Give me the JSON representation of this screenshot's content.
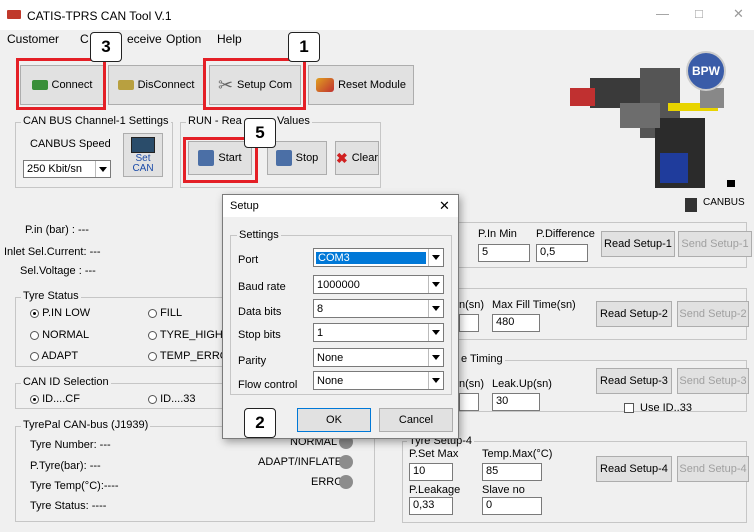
{
  "window": {
    "title": "CATIS-TPRS CAN Tool V.1",
    "minimize": "—",
    "maximize": "□",
    "close": "✕"
  },
  "menu": [
    "Customer",
    "C",
    "eceive",
    "Option",
    "Help"
  ],
  "toolbar": {
    "connect": "Connect",
    "disconnect": "DisConnect",
    "setup_com": "Setup Com",
    "reset_module": "Reset Module"
  },
  "can_bus": {
    "legend": "CAN BUS Channel-1 Settings",
    "speed_label": "CANBUS Speed",
    "speed_value": "250 Kbit/sn",
    "set_can": "Set CAN"
  },
  "run": {
    "legend_left": "RUN - Rea",
    "legend_right": "Values",
    "start": "Start",
    "stop": "Stop",
    "clear": "Clear"
  },
  "readings": {
    "pin": "P.in (bar)      : ---",
    "inlet": "Inlet Sel.Current: ---",
    "sel_voltage": "Sel.Voltage   : ---"
  },
  "tyre_status": {
    "legend": "Tyre Status",
    "options": [
      "P.IN LOW",
      "FILL",
      "NORMAL",
      "TYRE_HIGH",
      "ADAPT",
      "TEMP_ERROR"
    ]
  },
  "can_id": {
    "legend": "CAN ID Selection",
    "options": [
      "ID....CF",
      "ID....33"
    ]
  },
  "tyrepal": {
    "legend": "TyrePal CAN-bus (J1939)",
    "tyre_number": "Tyre Number: ---",
    "ptyre": "P.Tyre(bar):   ---",
    "temp": "Tyre Temp(°C):----",
    "status": "Tyre Status:   ----"
  },
  "leds": {
    "normal": "NORMAL",
    "adapt": "ADAPT/INFLATE",
    "error": "ERROR"
  },
  "setup1": {
    "pin_min_label": "P.In Min",
    "pin_min": "5",
    "pdiff_label": "P.Difference",
    "pdiff": "0,5",
    "read": "Read Setup-1",
    "send": "Send Setup-1"
  },
  "setup2": {
    "label_a": "n(sn)",
    "label_b": "Max Fill Time(sn)",
    "value_b": "480",
    "read": "Read Setup-2",
    "send": "Send Setup-2"
  },
  "setup3": {
    "legend": "e Timing",
    "label_a": "n(sn)",
    "label_b": "Leak.Up(sn)",
    "value_b": "30",
    "use_id": "Use ID..33",
    "read": "Read Setup-3",
    "send": "Send Setup-3"
  },
  "setup4": {
    "legend": "Tyre Setup-4",
    "pset_label": "P.Set Max",
    "pset": "10",
    "tmax_label": "Temp.Max(°C)",
    "tmax": "85",
    "leak_label": "P.Leakage",
    "leak": "0,33",
    "slave_label": "Slave no",
    "slave": "0",
    "read": "Read Setup-4",
    "send": "Send Setup-4"
  },
  "device": {
    "brand": "BPW",
    "status": "CANBUS"
  },
  "dialog": {
    "title": "Setup",
    "group": "Settings",
    "port_label": "Port",
    "port": "COM3",
    "baud_label": "Baud rate",
    "baud": "1000000",
    "databits_label": "Data bits",
    "databits": "8",
    "stopbits_label": "Stop bits",
    "stopbits": "1",
    "parity_label": "Parity",
    "parity": "None",
    "flow_label": "Flow control",
    "flow": "None",
    "ok": "OK",
    "cancel": "Cancel",
    "close": "✕"
  },
  "badges": [
    "1",
    "2",
    "3",
    "5"
  ],
  "colors": {
    "callout": "#e41f26",
    "selection": "#0078d7"
  }
}
